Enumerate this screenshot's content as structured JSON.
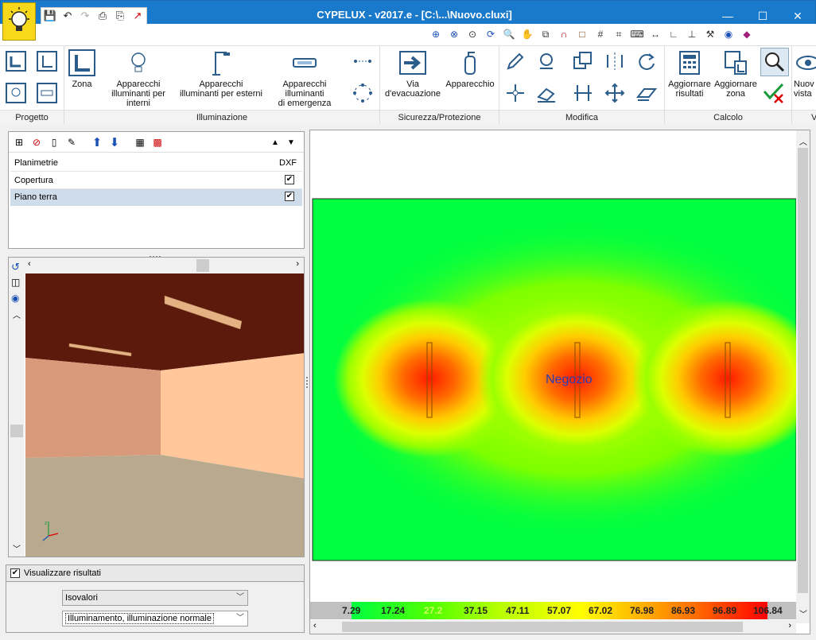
{
  "window": {
    "title": "CYPELUX - v2017.e - [C:\\...\\Nuovo.cluxi]"
  },
  "ribbon": {
    "groups": {
      "progetto": "Progetto",
      "illuminazione": "Illuminazione",
      "sicurezza": "Sicurezza/Protezione",
      "modifica": "Modifica",
      "calcolo": "Calcolo"
    },
    "buttons": {
      "zona": "Zona",
      "apparecchi_interni_1": "Apparecchi",
      "apparecchi_interni_2": "illuminanti per interni",
      "apparecchi_esterni_1": "Apparecchi",
      "apparecchi_esterni_2": "illuminanti per esterni",
      "apparecchi_emergenza_1": "Apparecchi illuminanti",
      "apparecchi_emergenza_2": "di emergenza",
      "via_1": "Via",
      "via_2": "d'evacuazione",
      "apparecchio": "Apparecchio",
      "aggiornare_risultati_1": "Aggiornare",
      "aggiornare_risultati_2": "risultati",
      "aggiornare_zona_1": "Aggiornare",
      "aggiornare_zona_2": "zona",
      "nuova_vista_1": "Nuov",
      "nuova_vista_2": "vista"
    }
  },
  "planimetrie": {
    "header": "Planimetrie",
    "dxf_header": "DXF",
    "rows": [
      {
        "name": "Copertura",
        "dxf": "✔"
      },
      {
        "name": "Piano terra",
        "dxf": "✔"
      }
    ]
  },
  "results": {
    "checkbox_label": "Visualizzare risultati",
    "checked": "✔",
    "mode": "Isovalori",
    "quantity": "Illuminamento, illuminazione normale"
  },
  "plan": {
    "zone_label": "Negozio"
  },
  "legend": {
    "values": [
      "7.29",
      "17.24",
      "27.2",
      "37.15",
      "47.11",
      "57.07",
      "67.02",
      "76.98",
      "86.93",
      "96.89",
      "106.84"
    ]
  },
  "colors": {
    "titlebar": "#1979ca",
    "heat_low": "#00ff40",
    "heat_high": "#ff0000"
  }
}
